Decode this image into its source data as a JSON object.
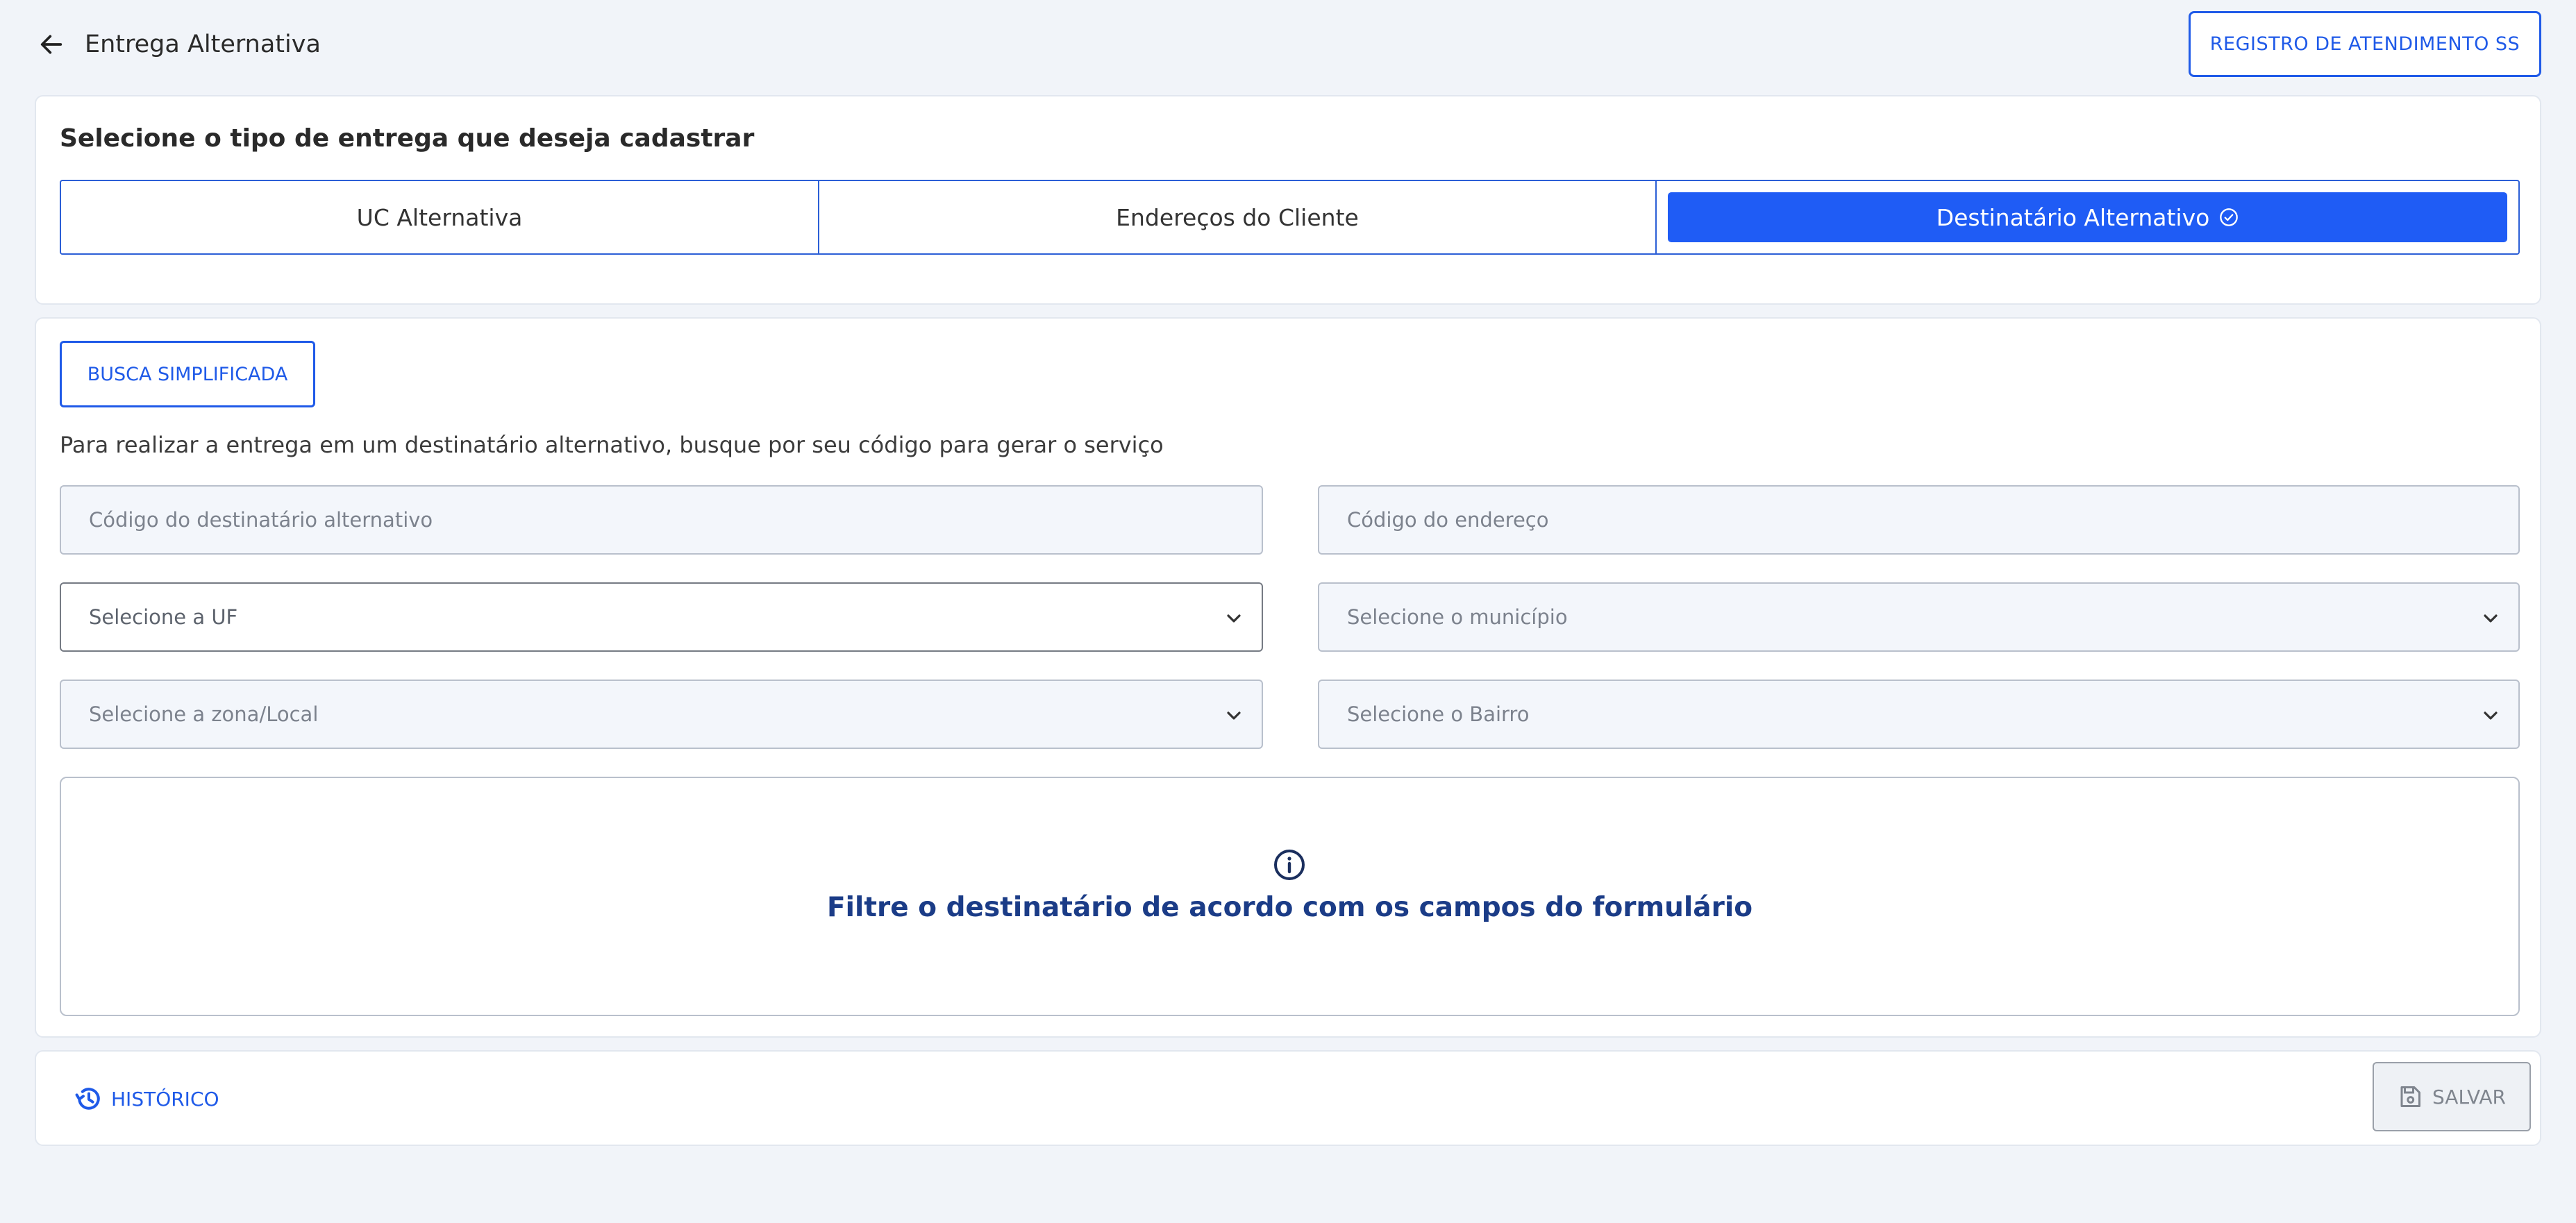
{
  "header": {
    "title": "Entrega Alternativa",
    "registro_button": "REGISTRO DE ATENDIMENTO SS"
  },
  "type_selector": {
    "title": "Selecione o tipo de entrega que deseja cadastrar",
    "options": [
      {
        "label": "UC Alternativa",
        "selected": false
      },
      {
        "label": "Endereços do Cliente",
        "selected": false
      },
      {
        "label": "Destinatário Alternativo",
        "selected": true
      }
    ]
  },
  "form": {
    "busca_button": "BUSCA SIMPLIFICADA",
    "description": "Para realizar a entrega em um destinatário alternativo, busque por seu código para gerar o serviço",
    "fields": {
      "codigo_destinatario": {
        "placeholder": "Código do destinatário alternativo",
        "value": ""
      },
      "codigo_endereco": {
        "placeholder": "Código do endereço",
        "value": ""
      },
      "uf": {
        "placeholder": "Selecione a UF",
        "value": ""
      },
      "municipio": {
        "placeholder": "Selecione o município",
        "value": ""
      },
      "zona": {
        "placeholder": "Selecione a zona/Local",
        "value": ""
      },
      "bairro": {
        "placeholder": "Selecione o Bairro",
        "value": ""
      }
    },
    "info_message": "Filtre o destinatário de acordo com os campos do formulário"
  },
  "footer": {
    "historico_label": "HISTÓRICO",
    "salvar_label": "SALVAR"
  },
  "colors": {
    "accent": "#1f5cf5",
    "link": "#1f5ae8",
    "info_text": "#1b3c87",
    "background": "#f1f4f9"
  },
  "icons": [
    "arrow-left-icon",
    "check-circle-icon",
    "chevron-down-icon",
    "info-icon",
    "history-icon",
    "floppy-disk-icon"
  ]
}
